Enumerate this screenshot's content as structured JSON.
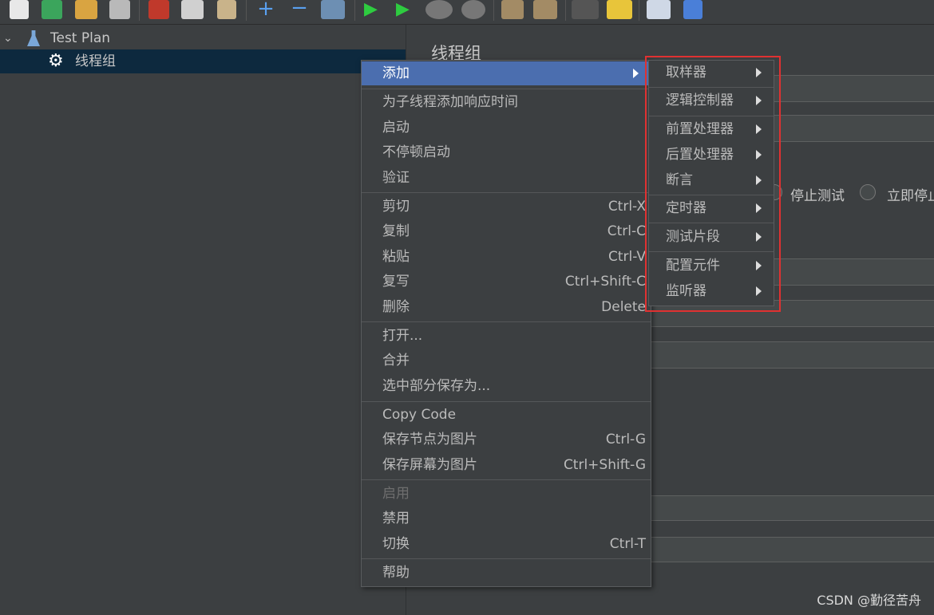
{
  "tree": {
    "root_label": "Test Plan",
    "child_label": "线程组"
  },
  "panel": {
    "title": "线程组",
    "radio_stop_test": "停止测试",
    "radio_stop_now": "立即停止"
  },
  "menu": {
    "items": [
      {
        "label": "添加",
        "shortcut": "",
        "submenu": true
      },
      {
        "label": "为子线程添加响应时间",
        "shortcut": ""
      },
      {
        "label": "启动",
        "shortcut": ""
      },
      {
        "label": "不停顿启动",
        "shortcut": ""
      },
      {
        "label": "验证",
        "shortcut": ""
      },
      {
        "label": "剪切",
        "shortcut": "Ctrl-X"
      },
      {
        "label": "复制",
        "shortcut": "Ctrl-C"
      },
      {
        "label": "粘贴",
        "shortcut": "Ctrl-V"
      },
      {
        "label": "复写",
        "shortcut": "Ctrl+Shift-C"
      },
      {
        "label": "删除",
        "shortcut": "Delete"
      },
      {
        "label": "打开...",
        "shortcut": ""
      },
      {
        "label": "合并",
        "shortcut": ""
      },
      {
        "label": "选中部分保存为...",
        "shortcut": ""
      },
      {
        "label": "Copy Code",
        "shortcut": ""
      },
      {
        "label": "保存节点为图片",
        "shortcut": "Ctrl-G"
      },
      {
        "label": "保存屏幕为图片",
        "shortcut": "Ctrl+Shift-G"
      },
      {
        "label": "启用",
        "shortcut": "",
        "disabled": true
      },
      {
        "label": "禁用",
        "shortcut": ""
      },
      {
        "label": "切换",
        "shortcut": "Ctrl-T"
      },
      {
        "label": "帮助",
        "shortcut": ""
      }
    ]
  },
  "submenu": {
    "items": [
      {
        "label": "取样器"
      },
      {
        "label": "逻辑控制器"
      },
      {
        "label": "前置处理器"
      },
      {
        "label": "后置处理器"
      },
      {
        "label": "断言"
      },
      {
        "label": "定时器"
      },
      {
        "label": "测试片段"
      },
      {
        "label": "配置元件"
      },
      {
        "label": "监听器"
      }
    ]
  },
  "watermark": "CSDN @勤径苦舟",
  "colors": {
    "highlight": "#4b6eaf",
    "annotation_box": "#e03131",
    "background": "#3c3f41",
    "selected_tree_row": "#0d293e"
  }
}
